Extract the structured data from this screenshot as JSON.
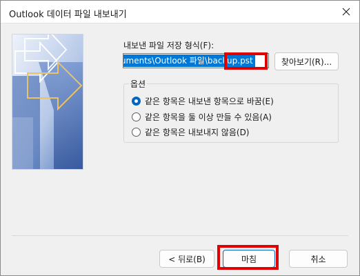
{
  "window": {
    "title": "Outlook 데이터 파일 내보내기"
  },
  "format_label": "내보낸 파일 저장 형식(F):",
  "path_value": "ocuments\\Outlook 파일\\backup.pst",
  "browse_button": "찾아보기(R)...",
  "options": {
    "label": "옵션",
    "items": [
      {
        "label": "같은 항목은 내보낸 항목으로 바꿈(E)",
        "selected": true
      },
      {
        "label": "같은 항목을 둘 이상 만들 수 있음(A)",
        "selected": false
      },
      {
        "label": "같은 항목은 내보내지 않음(D)",
        "selected": false
      }
    ]
  },
  "buttons": {
    "back": "< 뒤로(B)",
    "finish": "마침",
    "cancel": "취소"
  },
  "colors": {
    "selection": "#0078d7",
    "highlight": "#e00000",
    "accent": "#0067c0"
  },
  "icons": {
    "close": "close-icon",
    "banner": "wizard-banner-arrows"
  }
}
